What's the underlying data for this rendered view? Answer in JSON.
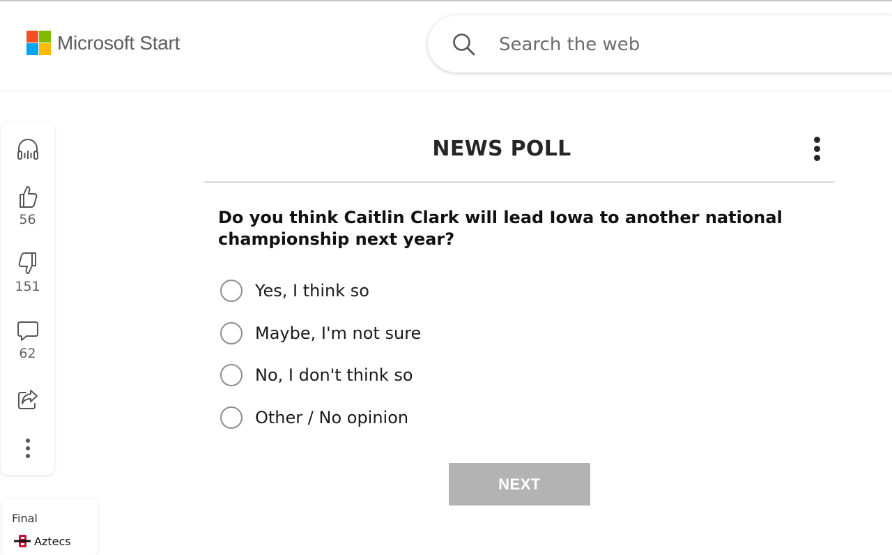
{
  "header": {
    "brand_name": "Microsoft Start",
    "search": {
      "placeholder": "Search the web",
      "value": ""
    }
  },
  "action_rail": {
    "items": [
      {
        "icon": "headphones-icon",
        "label": ""
      },
      {
        "icon": "thumbs-up-icon",
        "count": "56"
      },
      {
        "icon": "thumbs-down-icon",
        "count": "151"
      },
      {
        "icon": "comment-icon",
        "count": "62"
      },
      {
        "icon": "share-icon",
        "label": ""
      },
      {
        "icon": "more-vertical-icon",
        "label": ""
      }
    ]
  },
  "poll": {
    "title": "NEWS POLL",
    "question": "Do you think Caitlin Clark will lead Iowa to another national championship next year?",
    "options": [
      "Yes, I think so",
      "Maybe, I'm not sure",
      "No, I don't think so",
      "Other / No opinion"
    ],
    "next_label": "NEXT"
  },
  "score_card": {
    "status": "Final",
    "team": "Aztecs",
    "team_logo_icon": "sdsu-aztecs-logo"
  },
  "colors": {
    "accent_grey_button": "#b3b3b3",
    "ms_red": "#f25022",
    "ms_green": "#7fba00",
    "ms_blue": "#00a4ef",
    "ms_yellow": "#ffb900",
    "aztecs_red": "#c41230"
  }
}
